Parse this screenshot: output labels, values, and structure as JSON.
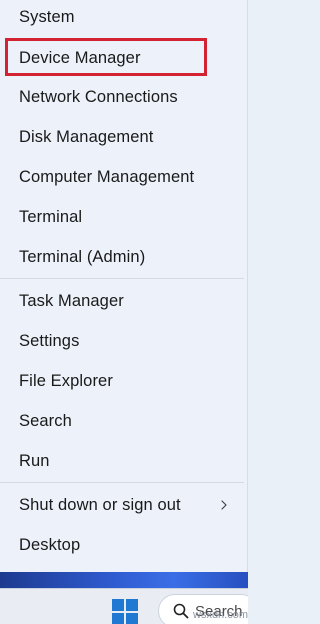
{
  "menu": {
    "items": [
      {
        "label": "System"
      },
      {
        "label": "Device Manager",
        "highlighted": true
      },
      {
        "label": "Network Connections"
      },
      {
        "label": "Disk Management"
      },
      {
        "label": "Computer Management"
      },
      {
        "label": "Terminal"
      },
      {
        "label": "Terminal (Admin)"
      },
      {
        "label": "Task Manager"
      },
      {
        "label": "Settings"
      },
      {
        "label": "File Explorer"
      },
      {
        "label": "Search"
      },
      {
        "label": "Run"
      },
      {
        "label": "Shut down or sign out",
        "has_submenu": true
      },
      {
        "label": "Desktop"
      }
    ],
    "highlight_color": "#d32231",
    "submenu_icon": "chevron-right-icon"
  },
  "taskbar": {
    "start_icon": "windows-logo-icon",
    "search_icon": "search-icon",
    "search_text": "Search",
    "accent": "#1f78d1"
  },
  "watermark": "wsxdn.com"
}
